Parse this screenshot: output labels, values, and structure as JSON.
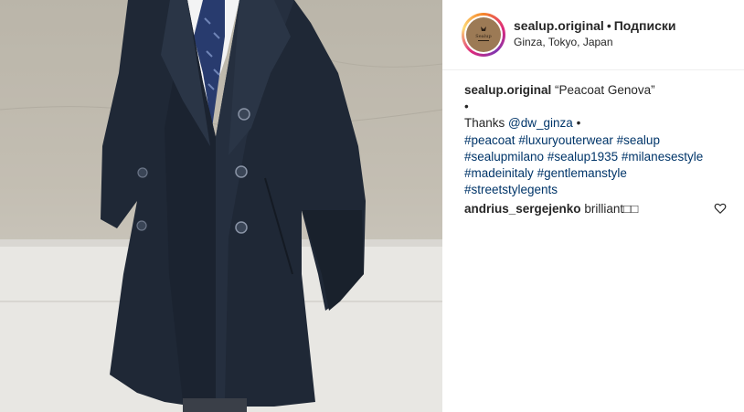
{
  "post": {
    "username": "sealup.original",
    "separator": "•",
    "follow_label": "Подписки",
    "location": "Ginza, Tokyo, Japan"
  },
  "caption": {
    "author": "sealup.original",
    "title": "“Peacoat Genova”",
    "bullet": "•",
    "thanks_prefix": "Thanks",
    "mention": "@dw_ginza",
    "thanks_suffix": "•",
    "hashtags": [
      "#peacoat",
      "#luxuryouterwear",
      "#sealup",
      "#sealupmilano",
      "#sealup1935",
      "#milanesestyle",
      "#madeinitaly",
      "#gentlemanstyle",
      "#streetstylegents"
    ]
  },
  "comment": {
    "author": "andrius_sergejenko",
    "text": "brilliant□□"
  },
  "icons": {
    "like": "heart-outline-icon",
    "avatar_logo": "sealup-logo"
  },
  "colors": {
    "link": "#003569",
    "text": "#262626",
    "coat": "#1f2836"
  }
}
